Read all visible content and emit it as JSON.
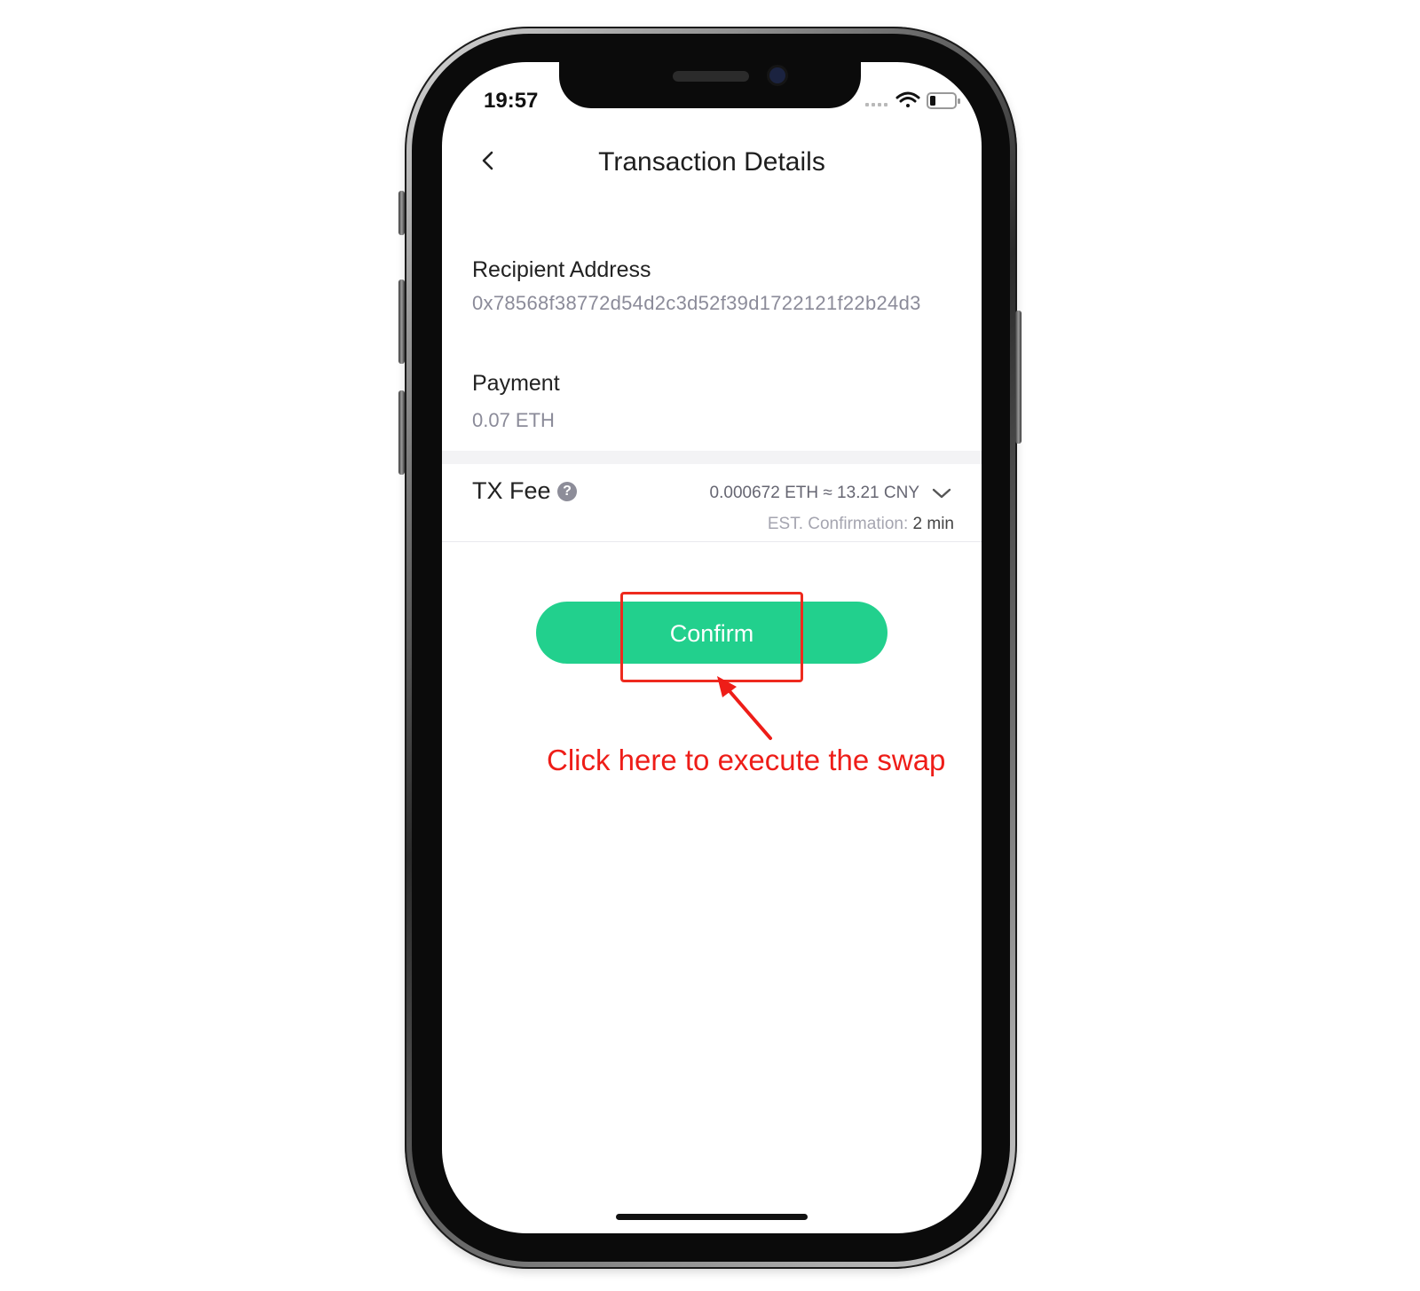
{
  "status_bar": {
    "time": "19:57"
  },
  "nav": {
    "title": "Transaction Details"
  },
  "recipient": {
    "label": "Recipient Address",
    "value": "0x78568f38772d54d2c3d52f39d1722121f22b24d3"
  },
  "payment": {
    "label": "Payment",
    "value": "0.07 ETH"
  },
  "fee": {
    "label": "TX Fee",
    "help_glyph": "?",
    "amount": "0.000672 ETH ≈ 13.21 CNY",
    "est_label": "EST. Confirmation:",
    "est_value": "2 min"
  },
  "actions": {
    "confirm_label": "Confirm"
  },
  "annotation": {
    "text": "Click here to execute the swap"
  },
  "colors": {
    "accent": "#22d08d",
    "annotation_red": "#ee1d18",
    "muted_text": "#8b8b99"
  },
  "icons": {
    "back": "chevron-left-icon",
    "help": "question-circle-icon",
    "expand": "chevron-down-icon",
    "wifi": "wifi-icon",
    "battery": "battery-icon",
    "signal": "signal-icon"
  }
}
